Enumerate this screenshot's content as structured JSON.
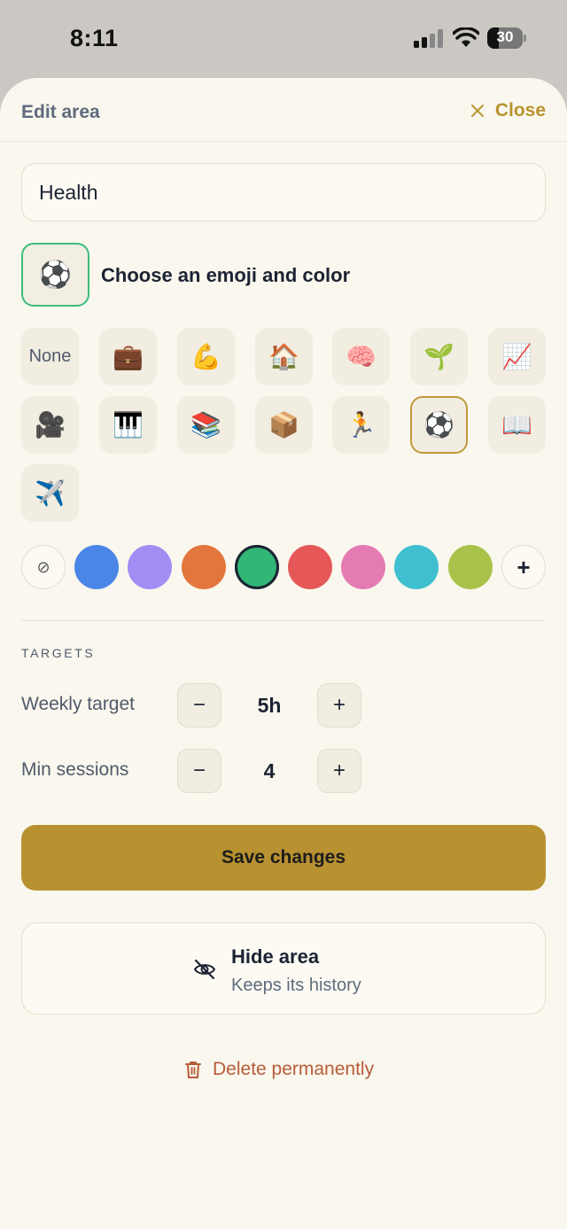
{
  "status": {
    "time": "8:11",
    "battery": "30"
  },
  "header": {
    "title": "Edit area",
    "close_label": "Close"
  },
  "name_field": {
    "value": "Health"
  },
  "emoji_picker": {
    "selected_emoji": "⚽",
    "label": "Choose an emoji and color",
    "options": [
      "None",
      "💼",
      "💪",
      "🏠",
      "🧠",
      "🌱",
      "📈",
      "🎥",
      "🎹",
      "📚",
      "📦",
      "🏃",
      "⚽",
      "📖",
      "✈️"
    ],
    "selected_index": 12
  },
  "colors": {
    "none_symbol": "⊘",
    "add_symbol": "+",
    "swatches": [
      "#4a86e8",
      "#a38cf4",
      "#e2763c",
      "#31b676",
      "#e65858",
      "#e57bb3",
      "#3fbfcf",
      "#a9c24a"
    ],
    "selected_index": 3
  },
  "targets": {
    "section_label": "TARGETS",
    "weekly": {
      "label": "Weekly target",
      "value": "5h",
      "minus": "−",
      "plus": "+"
    },
    "sessions": {
      "label": "Min sessions",
      "value": "4",
      "minus": "−",
      "plus": "+"
    }
  },
  "actions": {
    "save_label": "Save changes",
    "hide_title": "Hide area",
    "hide_subtitle": "Keeps its history",
    "delete_label": "Delete permanently"
  }
}
